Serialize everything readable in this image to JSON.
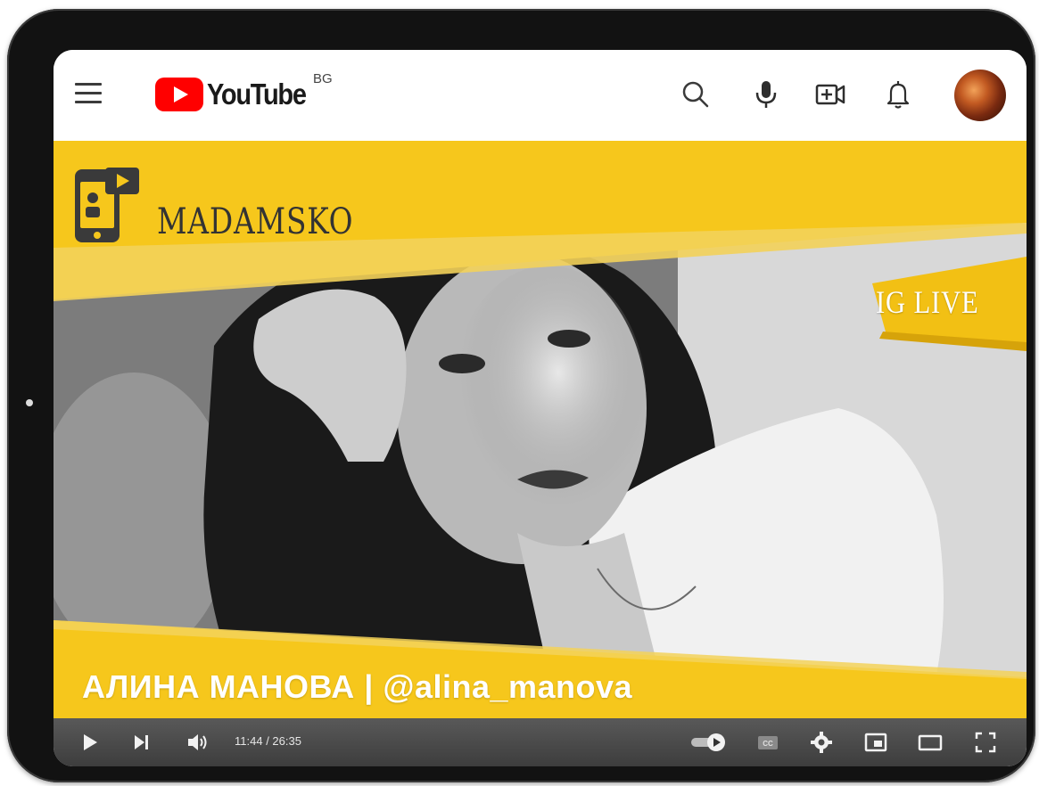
{
  "header": {
    "logo_text": "YouTube",
    "country_code": "BG",
    "icons": [
      "menu-icon",
      "search-icon",
      "microphone-icon",
      "create-video-icon",
      "notifications-bell-icon",
      "avatar"
    ]
  },
  "video": {
    "channel_name": "MADAMSKO",
    "badge": "IG LIVE",
    "caption": "АЛИНА МАНОВА | @alina_manova",
    "accent_color": "#f5c518"
  },
  "player": {
    "current_time": "11:44",
    "separator": " / ",
    "duration": "26:35",
    "controls": [
      "play-icon",
      "next-icon",
      "volume-icon",
      "autoplay-toggle",
      "subtitles-icon",
      "settings-icon",
      "miniplayer-icon",
      "theater-icon",
      "fullscreen-icon"
    ]
  }
}
